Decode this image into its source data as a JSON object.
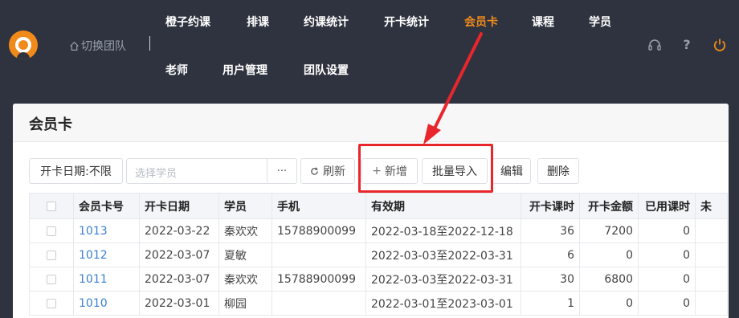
{
  "header": {
    "team_switch": "切换团队",
    "nav": [
      {
        "label": "橙子约课",
        "active": false
      },
      {
        "label": "排课",
        "active": false
      },
      {
        "label": "约课统计",
        "active": false
      },
      {
        "label": "开卡统计",
        "active": false
      },
      {
        "label": "会员卡",
        "active": true
      },
      {
        "label": "课程",
        "active": false
      },
      {
        "label": "学员",
        "active": false
      },
      {
        "label": "老师",
        "active": false
      },
      {
        "label": "用户管理",
        "active": false
      },
      {
        "label": "团队设置",
        "active": false
      }
    ],
    "icons": [
      "headset-icon",
      "help-icon",
      "power-icon"
    ],
    "accent_color": "#f08a1a"
  },
  "panel": {
    "title": "会员卡",
    "toolbar": {
      "date_filter": "开卡日期:不限",
      "student_placeholder": "选择学员",
      "more": "···",
      "refresh": "刷新",
      "add": "新增",
      "batch_import": "批量导入",
      "edit": "编辑",
      "delete": "删除"
    },
    "table": {
      "columns": [
        "会员卡号",
        "开卡日期",
        "学员",
        "手机",
        "有效期",
        "开卡课时",
        "开卡金额",
        "已用课时",
        "未"
      ],
      "rows": [
        {
          "card_no": "1013",
          "open_date": "2022-03-22",
          "student": "秦欢欢",
          "phone": "15788900099",
          "validity": "2022-03-18至2022-12-18",
          "hours": "36",
          "amount": "7200",
          "used": "0"
        },
        {
          "card_no": "1012",
          "open_date": "2022-03-07",
          "student": "夏敏",
          "phone": "",
          "validity": "2022-03-03至2022-03-31",
          "hours": "6",
          "amount": "0",
          "used": "0"
        },
        {
          "card_no": "1011",
          "open_date": "2022-03-07",
          "student": "秦欢欢",
          "phone": "15788900099",
          "validity": "2022-03-03至2022-03-31",
          "hours": "30",
          "amount": "6800",
          "used": "0"
        },
        {
          "card_no": "1010",
          "open_date": "2022-03-01",
          "student": "柳园",
          "phone": "",
          "validity": "2022-03-01至2023-03-01",
          "hours": "1",
          "amount": "0",
          "used": "0"
        }
      ]
    }
  },
  "annotation": {
    "color": "#e8262b"
  }
}
